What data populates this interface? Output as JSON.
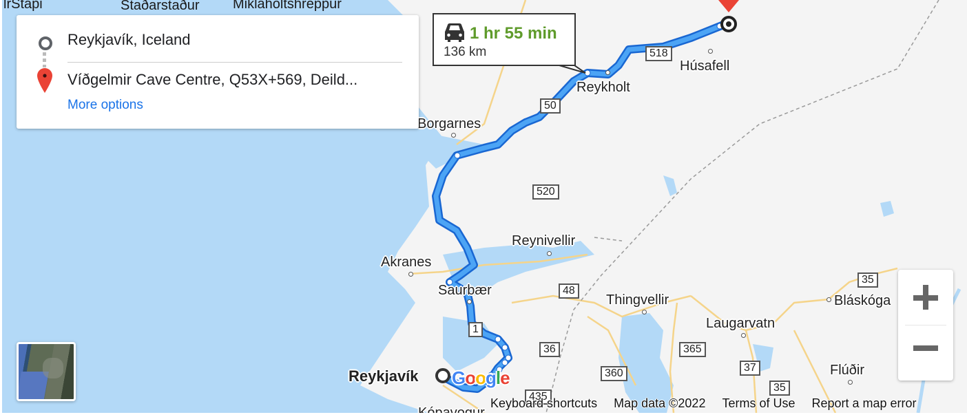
{
  "directions": {
    "origin": "Reykjavík, Iceland",
    "destination": "Víðgelmir Cave Centre, Q53X+569, Deild...",
    "more_options": "More options"
  },
  "route": {
    "mode_icon": "car-icon",
    "duration": "1 hr 55 min",
    "distance": "136 km",
    "color": "#4285f4",
    "duration_color": "#5f9b2b"
  },
  "places": {
    "stapi": "lrStapi",
    "stadarstadur": "Staðarstaður",
    "miklaholtshreppur": "Miklaholtshreppur",
    "husafell": "Húsafell",
    "reykholt": "Reykholt",
    "borgarnes": "Borgarnes",
    "akranes": "Akranes",
    "reynivellir": "Reynivellir",
    "saurbaer": "Saurbær",
    "thingvellir": "Thingvellir",
    "laugarvatn": "Laugarvatn",
    "blaskoga": "Bláskóga",
    "fludir": "Flúðir",
    "reykjavik": "Reykjavík",
    "kopavogur": "Kópavogur"
  },
  "roads": {
    "r518": "518",
    "r50": "50",
    "r520": "520",
    "r48": "48",
    "r1": "1",
    "r36": "36",
    "r35a": "35",
    "r35b": "35",
    "r365": "365",
    "r360": "360",
    "r37": "37",
    "r435": "435"
  },
  "controls": {
    "zoom_in": "+",
    "zoom_out": "−",
    "layer": "Satellite"
  },
  "footer": {
    "keyboard": "Keyboard shortcuts",
    "map_data": "Map data ©2022",
    "terms": "Terms of Use",
    "report": "Report a map error"
  },
  "logo": [
    "G",
    "o",
    "o",
    "g",
    "l",
    "e"
  ]
}
